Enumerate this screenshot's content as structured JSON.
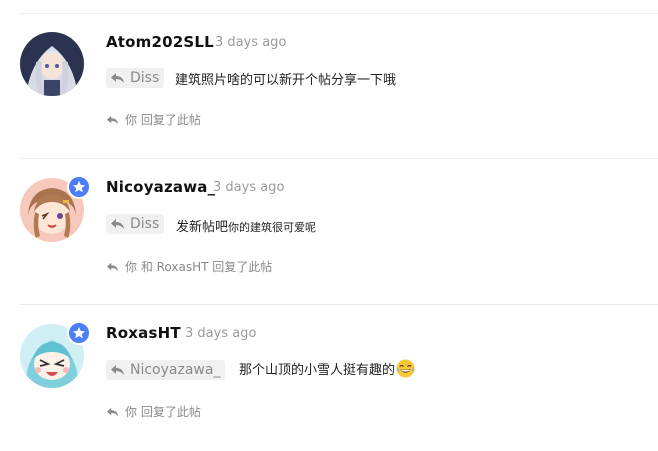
{
  "comments": [
    {
      "username": "Atom202SLL",
      "time": "3 days ago",
      "reply_to": "Diss",
      "text": "建筑照片啥的可以新开个帖分享一下哦",
      "replied_note": "你 回复了此帖",
      "has_badge": false
    },
    {
      "username": "Nicoyazawa_",
      "time": "3 days ago",
      "reply_to": "Diss",
      "text_main": "发新帖吧",
      "text_small": "你的建筑很可爱呢",
      "replied_note": "你 和 RoxasHT 回复了此帖",
      "has_badge": true
    },
    {
      "username": "RoxasHT",
      "time": "3 days ago",
      "reply_to": "Nicoyazawa_",
      "text": "那个山顶的小雪人挺有趣的",
      "emoji": "joy-emoji",
      "replied_note": "你 回复了此帖",
      "has_badge": true
    }
  ],
  "icons": {
    "reply": "reply-arrow-icon",
    "badge": "star-badge-icon"
  },
  "colors": {
    "badge": "#4d7ef7",
    "muted": "#8a8a8a",
    "tag_bg": "#f0f0f0",
    "divider": "#ececec"
  }
}
